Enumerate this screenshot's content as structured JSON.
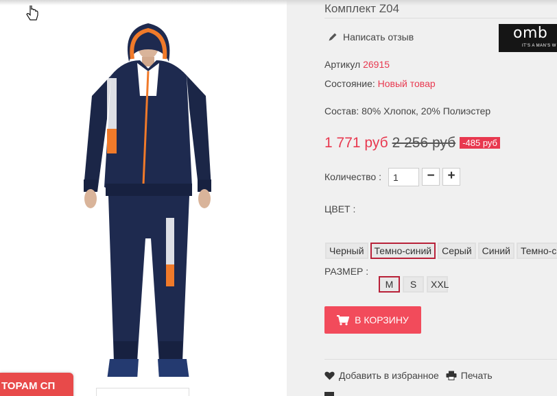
{
  "product": {
    "title": "Комплект Z04",
    "review_link": "Написать отзыв",
    "article_label": "Артикул",
    "article_value": "26915",
    "condition_label": "Состояние:",
    "condition_value": "Новый товар",
    "composition": "Состав: 80% Хлопок, 20% Полиэстер"
  },
  "brand": {
    "name": "omb",
    "tagline": "IT'S A MAN'S W"
  },
  "price": {
    "current": "1 771 руб",
    "old": "2 256 руб",
    "discount": "-485 руб"
  },
  "quantity": {
    "label": "Количество :",
    "value": "1",
    "minus": "−",
    "plus": "+"
  },
  "color": {
    "label": "ЦВЕТ :",
    "options": [
      "Черный",
      "Темно-синий",
      "Серый",
      "Синий",
      "Темно-сер"
    ],
    "selected": "Темно-синий"
  },
  "size": {
    "label": "РАЗМЕР :",
    "options": [
      "M",
      "S",
      "XXL"
    ],
    "selected": "M"
  },
  "cart_button": "В КОРЗИНУ",
  "actions": {
    "wishlist": "Добавить в избранное",
    "print": "Печать"
  },
  "promo": "ТОРАМ СП",
  "colors": {
    "accent": "#e8384f",
    "button": "#f24b5b",
    "selected_border": "#b82038",
    "garment": "#1e2a4f",
    "garment_accent": "#f07a2a"
  }
}
